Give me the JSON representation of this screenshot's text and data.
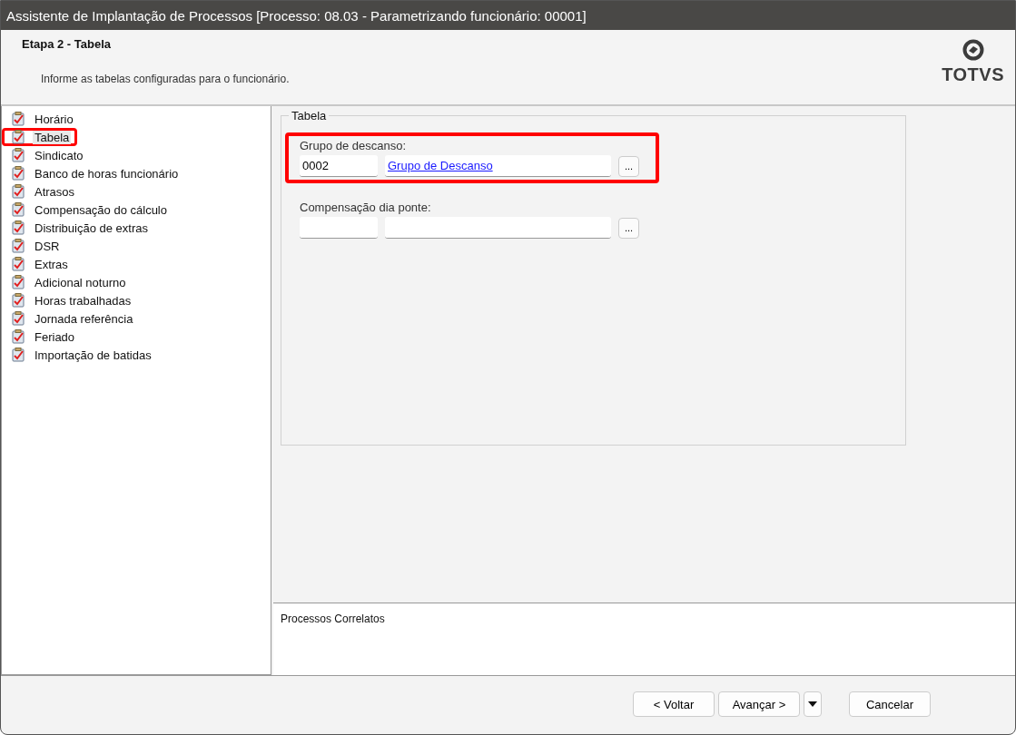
{
  "window": {
    "title": "Assistente de Implantação de Processos [Processo: 08.03 - Parametrizando funcionário: 00001]"
  },
  "header": {
    "step_title": "Etapa 2 - Tabela",
    "description": "Informe as tabelas configuradas para o funcionário.",
    "logo_text": "TOTVS"
  },
  "sidebar": {
    "items": [
      {
        "label": "Horário",
        "selected": false,
        "highlighted": false
      },
      {
        "label": "Tabela",
        "selected": true,
        "highlighted": true
      },
      {
        "label": "Sindicato",
        "selected": false,
        "highlighted": false
      },
      {
        "label": "Banco de horas funcionário",
        "selected": false,
        "highlighted": false
      },
      {
        "label": "Atrasos",
        "selected": false,
        "highlighted": false
      },
      {
        "label": "Compensação do cálculo",
        "selected": false,
        "highlighted": false
      },
      {
        "label": "Distribuição de extras",
        "selected": false,
        "highlighted": false
      },
      {
        "label": "DSR",
        "selected": false,
        "highlighted": false
      },
      {
        "label": "Extras",
        "selected": false,
        "highlighted": false
      },
      {
        "label": "Adicional noturno",
        "selected": false,
        "highlighted": false
      },
      {
        "label": "Horas trabalhadas",
        "selected": false,
        "highlighted": false
      },
      {
        "label": "Jornada referência",
        "selected": false,
        "highlighted": false
      },
      {
        "label": "Feriado",
        "selected": false,
        "highlighted": false
      },
      {
        "label": "Importação de batidas",
        "selected": false,
        "highlighted": false
      }
    ]
  },
  "group": {
    "title": "Tabela",
    "fields": [
      {
        "label": "Grupo de descanso:",
        "code": "0002",
        "description": "Grupo de Descanso",
        "lookup_button": "...",
        "highlighted": true
      },
      {
        "label": "Compensação dia ponte:",
        "lookup_button": "...",
        "highlighted": false
      }
    ]
  },
  "related": {
    "title": "Processos Correlatos"
  },
  "buttons": {
    "back": "< Voltar",
    "next": "Avançar >",
    "cancel": "Cancelar"
  }
}
